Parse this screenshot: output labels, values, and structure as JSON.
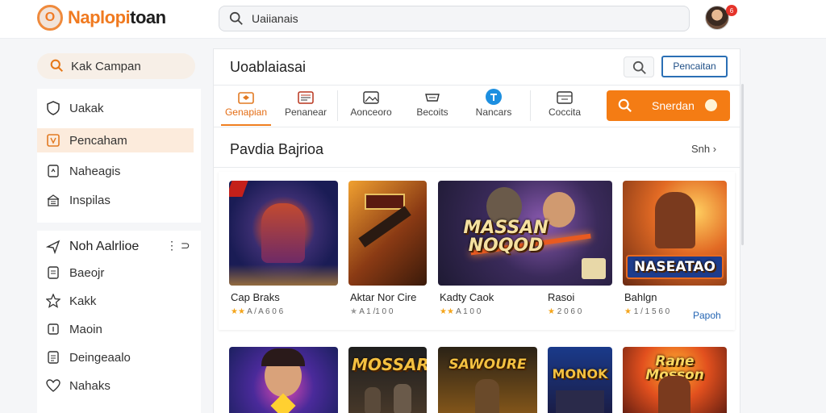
{
  "header": {
    "logo_mark": "O",
    "logo_part1": "Naplopi",
    "logo_part2": "toan",
    "search_value": "Uaiianais",
    "search_icon": "search-icon",
    "notification_count": "6"
  },
  "sidebar": {
    "search_label": "Kak Campan",
    "items_top": [
      {
        "label": "Uakak",
        "icon": "shield-icon"
      },
      {
        "label": "Pencaham",
        "icon": "box-icon",
        "active": true
      },
      {
        "label": "Naheagis",
        "icon": "document-icon"
      },
      {
        "label": "Inspilas",
        "icon": "building-icon"
      }
    ],
    "section_title": "Noh Aalrlioe",
    "section_more": "⋮ ⊃",
    "items_bottom": [
      {
        "label": "Baeojr",
        "icon": "document-icon"
      },
      {
        "label": "Kakk",
        "icon": "star-icon"
      },
      {
        "label": "Maoin",
        "icon": "square-icon"
      },
      {
        "label": "Deingeaalo",
        "icon": "list-icon"
      },
      {
        "label": "Nahaks",
        "icon": "heart-icon"
      }
    ]
  },
  "main": {
    "title": "Uoablaiasai",
    "action_label": "Pencaitan",
    "tabs": [
      {
        "label": "Genapian",
        "active": true
      },
      {
        "label": "Penanear"
      },
      {
        "label": "Aonceoro"
      },
      {
        "label": "Becoits"
      },
      {
        "label": "Nancars"
      },
      {
        "label": "Coccita"
      }
    ],
    "big_button_label": "Snerdan",
    "section_title": "Pavdia Bajrioa",
    "section_link": "Snh ›",
    "cards_row1": [
      {
        "name": "Cap Braks",
        "meta": "A / A 6 0 6",
        "thumb": ""
      },
      {
        "name": "Aktar Nor Cire",
        "meta": "A 1 /1 0 0",
        "thumb": ""
      },
      {
        "name": "Kadty Caok",
        "meta": "A 1 0 0",
        "thumb": "MASSAN NOQOD"
      },
      {
        "name": "Rasoi",
        "meta": "2 0 6 0",
        "thumb": ""
      },
      {
        "name": "Bahlgn",
        "meta": "1 / 1 5 6 0",
        "thumb": "NASEATAO",
        "link": "Papoh"
      }
    ],
    "cards_row2": [
      {
        "thumb": ""
      },
      {
        "thumb": "MOSSAR"
      },
      {
        "thumb": "SAWOURE"
      },
      {
        "thumb": "MONOK"
      },
      {
        "thumb": "Rane Mosson"
      }
    ]
  }
}
